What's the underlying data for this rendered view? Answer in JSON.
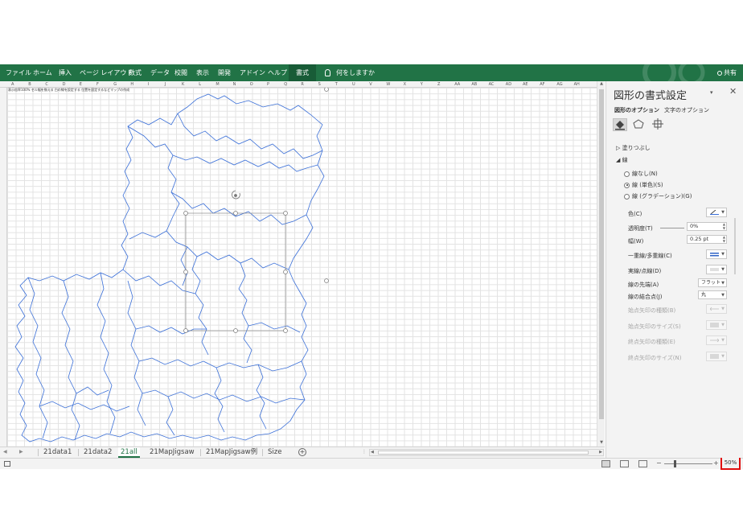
{
  "ribbon": {
    "tabs": [
      "ファイル",
      "ホーム",
      "挿入",
      "ページ レイアウト",
      "数式",
      "データ",
      "校閲",
      "表示",
      "開発",
      "アドイン",
      "ヘルプ"
    ],
    "active_tab": "書式",
    "tell_me": "何をしますか",
    "share": "共有"
  },
  "grid": {
    "columns": [
      "A",
      "B",
      "C",
      "D",
      "E",
      "F",
      "G",
      "H",
      "I",
      "J",
      "K",
      "L",
      "M",
      "N",
      "O",
      "P",
      "Q",
      "R",
      "S",
      "T",
      "U",
      "V",
      "W",
      "X",
      "Y",
      "Z",
      "AA",
      "AB",
      "AC",
      "AD",
      "AE",
      "AF",
      "AG",
      "AH"
    ],
    "cell_text": "表示倍率100% セル幅を揃える 白の線を設定する 位置を固定するなどマップの作成"
  },
  "sheets": {
    "tabs": [
      "21data1",
      "21data2",
      "21all",
      "21MapJigsaw",
      "21MapJigsaw例",
      "Size"
    ],
    "active": "21all",
    "add_label": "+"
  },
  "status": {
    "zoom": "50%",
    "zoom_minus": "−",
    "zoom_plus": "+"
  },
  "pane": {
    "title": "図形の書式設定",
    "tabs": [
      "図形のオプション",
      "文字のオプション"
    ],
    "fill_section": "塗りつぶし",
    "line_section": "線",
    "line_options": [
      "線なし(N)",
      "線 (単色)(S)",
      "線 (グラデーション)(G)"
    ],
    "selected_option": 1,
    "color_label": "色(C)",
    "transparency_label": "透明度(T)",
    "transparency_value": "0%",
    "width_label": "幅(W)",
    "width_value": "0.25 pt",
    "compound_label": "一重線/多重線(C)",
    "dash_label": "実線/点線(D)",
    "cap_label": "線の先端(A)",
    "cap_value": "フラット",
    "join_label": "線の結合点(J)",
    "join_value": "丸",
    "begin_arrow_type_label": "始点矢印の種類(B)",
    "begin_arrow_size_label": "始点矢印のサイズ(S)",
    "end_arrow_type_label": "終点矢印の種類(E)",
    "end_arrow_size_label": "終点矢印のサイズ(N)",
    "accent": "#217346",
    "map_line_color": "#3a6fd8"
  }
}
